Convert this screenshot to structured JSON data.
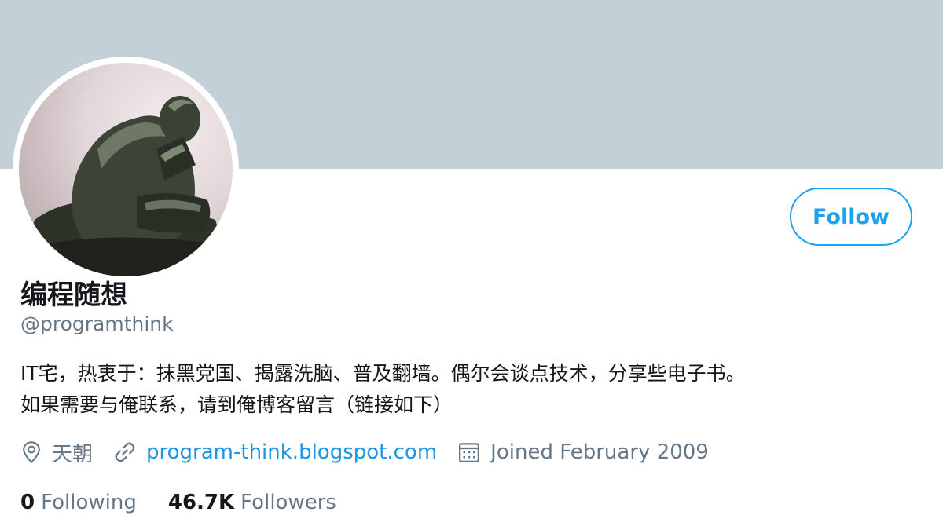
{
  "profile": {
    "display_name": "编程随想",
    "handle": "@programthink",
    "follow_label": "Follow",
    "bio_line1": "IT宅，热衷于：抹黑党国、揭露洗脑、普及翻墙。偶尔会谈点技术，分享些电子书。",
    "bio_line2": "如果需要与俺联系，请到俺博客留言（链接如下）",
    "location": "天朝",
    "website": "program-think.blogspot.com",
    "joined": "Joined February 2009",
    "following_count": "0",
    "following_label": "Following",
    "followers_count": "46.7K",
    "followers_label": "Followers"
  },
  "icons": {
    "location": "location-pin-icon",
    "link": "link-icon",
    "calendar": "calendar-icon"
  },
  "colors": {
    "banner": "#c4d0d8",
    "accent": "#1da1f2",
    "link": "#1b95e0",
    "secondary_text": "#657786",
    "primary_text": "#14171a"
  }
}
